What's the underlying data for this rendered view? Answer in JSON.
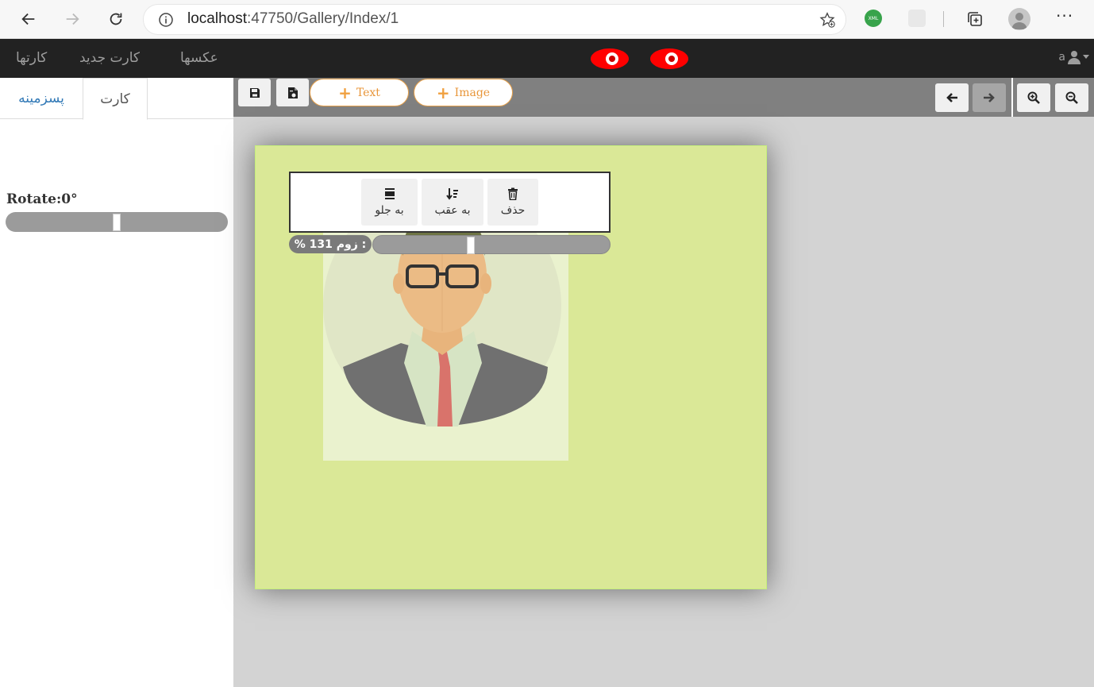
{
  "browser": {
    "url_host": "localhost",
    "url_path": ":47750/Gallery/Index/1",
    "extension_label": "XML"
  },
  "navbar": {
    "links": [
      "کارتها",
      "کارت جدید",
      "عکسها"
    ],
    "user": "a",
    "eye_color": "#ff0000"
  },
  "left_panel": {
    "tabs": {
      "card": "کارت",
      "background": "پسزمینه"
    },
    "rotate_label": "Rotate:0°",
    "rotate_value": 0.5
  },
  "toolbar": {
    "save_icon": "save-icon",
    "export_icon": "export-icon",
    "add_text": "Text",
    "add_image": "Image",
    "undo_icon": "arrow-left-icon",
    "redo_icon": "arrow-right-icon",
    "zoom_in_icon": "zoom-in-icon",
    "zoom_out_icon": "zoom-out-icon"
  },
  "editor": {
    "card_color": "#dae897",
    "context_menu": {
      "delete": "حذف",
      "send_back": "به عقب",
      "bring_front": "به جلو"
    },
    "zoom_label": "% 131 زوم :",
    "zoom_value": 0.41
  }
}
